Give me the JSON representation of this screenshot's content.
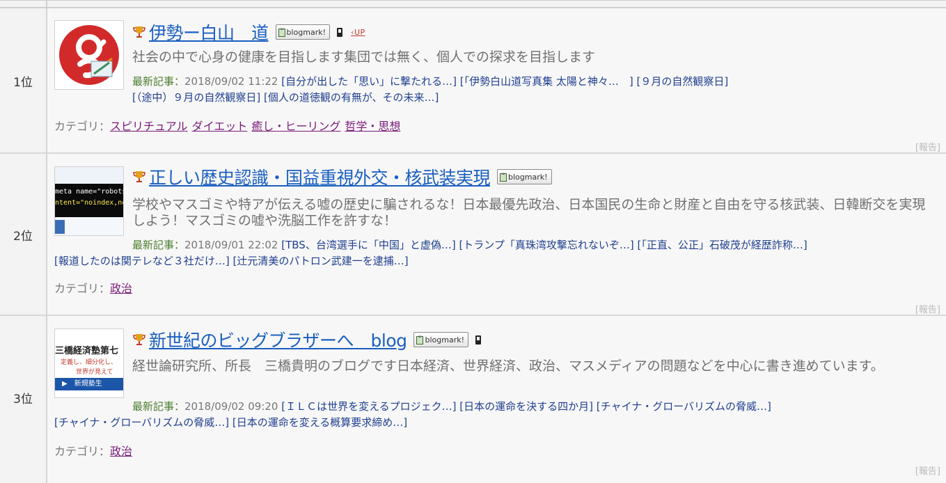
{
  "rows": [
    {
      "rank": "1位",
      "title": "伊勢ー白山　道",
      "blogmark": "blogmark!",
      "has_mobile": true,
      "has_up": true,
      "up_label": "UP",
      "description": "社会の中で心身の健康を目指します集団では無く、個人での探求を目指します",
      "latest_label": "最新記事：",
      "latest_date": "2018/09/02 11:22",
      "articles": [
        "[自分が出した「思い」に撃たれる…]",
        "[「伊勢白山道写真集 太陽と神々…　]",
        "[９月の自然観察日]",
        "[（途中）９月の自然観察日]",
        "[個人の道徳観の有無が、その未来…]"
      ],
      "category_label": "カテゴリ：",
      "categories": [
        "スピリチュアル",
        "ダイエット",
        "癒し・ヒーリング",
        "哲学・思想"
      ],
      "report": "[報告]"
    },
    {
      "rank": "2位",
      "title": "正しい歴史認識・国益重視外交・核武装実現",
      "blogmark": "blogmark!",
      "has_mobile": false,
      "has_up": false,
      "description": "学校やマスゴミや特アが伝える嘘の歴史に騙されるな！日本最優先政治、日本国民の生命と財産と自由を守る核武装、日韓断交を実現しよう！マスゴミの嘘や洗脳工作を許すな！",
      "latest_label": "最新記事：",
      "latest_date": "2018/09/01 22:02",
      "articles": [
        "[TBS、台湾選手に「中国」と虚偽…]",
        "[トランプ「真珠湾攻撃忘れないぞ…]",
        "[「正直、公正」石破茂が経歴詐称…]",
        "[報道したのは関テレなど３社だけ…]",
        "[辻元清美のパトロン武建一を逮捕…]"
      ],
      "category_label": "カテゴリ：",
      "categories": [
        "政治"
      ],
      "report": "[報告]",
      "thumb_text": {
        "l1": "meta name=\"robots\"",
        "l2": "ntent=\"noindex,nofo"
      }
    },
    {
      "rank": "3位",
      "title": "新世紀のビッグブラザーへ　blog",
      "blogmark": "blogmark!",
      "has_mobile": true,
      "has_up": false,
      "description": "経世論研究所、所長　三橋貴明のブログです日本経済、世界経済、政治、マスメディアの問題などを中心に書き進めています。",
      "latest_label": "最新記事：",
      "latest_date": "2018/09/02 09:20",
      "articles": [
        "[ＩＬＣは世界を変えるプロジェク…]",
        "[日本の運命を決する四か月]",
        "[チャイナ・グローバリズムの脅威…]",
        "[チャイナ・グローバリズムの脅威…]",
        "[日本の運命を変える概算要求締め…]"
      ],
      "category_label": "カテゴリ：",
      "categories": [
        "政治"
      ],
      "report": "[報告]",
      "thumb_text": {
        "l1": "三橋経済塾第七",
        "l2": "定義し、細分化し、",
        "l3": "世界が見えて",
        "btn": "▶　新規塾生"
      }
    }
  ],
  "colors": {
    "title_link": "#1a5fc0",
    "category_link": "#7a1a7a",
    "latest_label": "#4a7d2c",
    "article_link": "#1f3f8f"
  }
}
